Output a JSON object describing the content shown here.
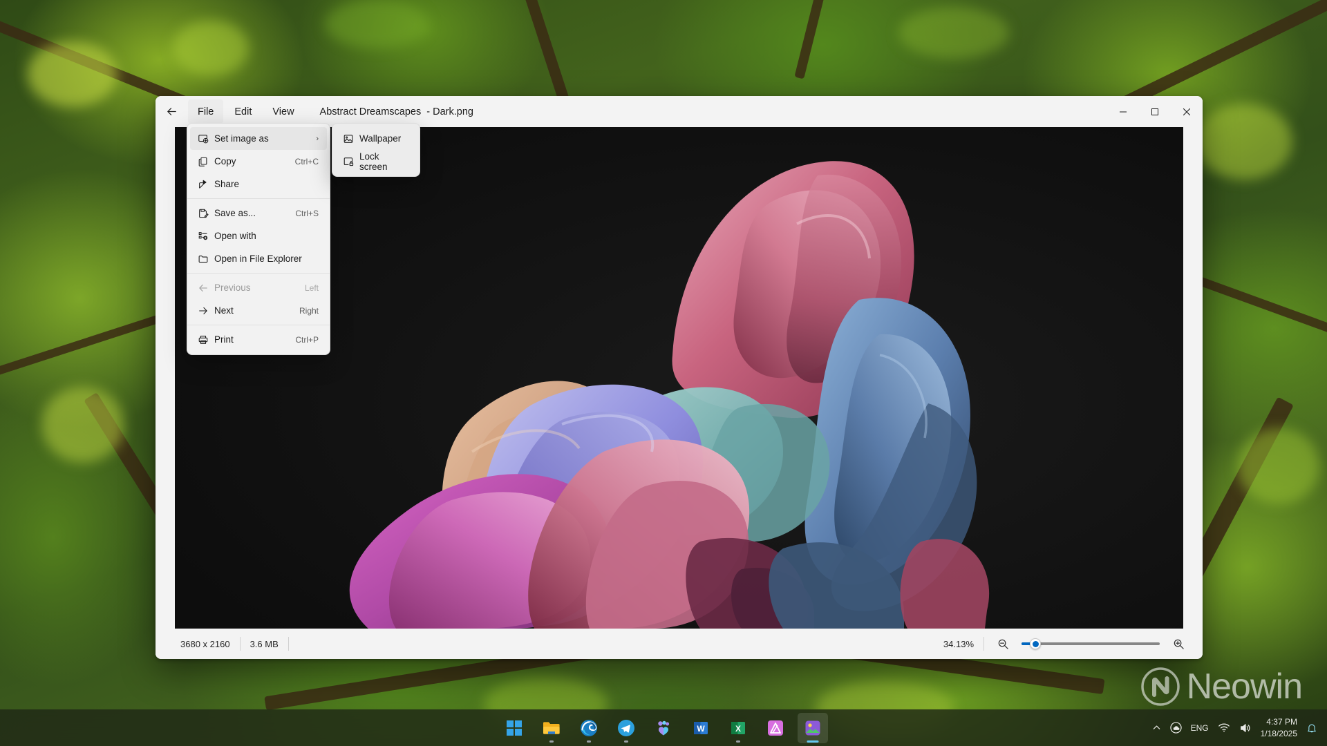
{
  "window": {
    "title": "Abstract Dreamscapes  - Dark.png",
    "back_icon": "back-arrow-icon",
    "menus": [
      {
        "label": "File",
        "active": true
      },
      {
        "label": "Edit",
        "active": false
      },
      {
        "label": "View",
        "active": false
      }
    ],
    "controls": {
      "minimize": "–",
      "maximize": "☐",
      "close": "✕"
    }
  },
  "file_menu": {
    "items": [
      {
        "label": "Set image as",
        "icon": "set-image-as-icon",
        "accel": "",
        "submenu": true,
        "disabled": false,
        "highlighted": true,
        "separator_after": false
      },
      {
        "label": "Copy",
        "icon": "copy-icon",
        "accel": "Ctrl+C",
        "submenu": false,
        "disabled": false,
        "highlighted": false,
        "separator_after": false
      },
      {
        "label": "Share",
        "icon": "share-icon",
        "accel": "",
        "submenu": false,
        "disabled": false,
        "highlighted": false,
        "separator_after": true
      },
      {
        "label": "Save as...",
        "icon": "save-as-icon",
        "accel": "Ctrl+S",
        "submenu": false,
        "disabled": false,
        "highlighted": false,
        "separator_after": false
      },
      {
        "label": "Open with",
        "icon": "open-with-icon",
        "accel": "",
        "submenu": false,
        "disabled": false,
        "highlighted": false,
        "separator_after": false
      },
      {
        "label": "Open in File Explorer",
        "icon": "folder-icon",
        "accel": "",
        "submenu": false,
        "disabled": false,
        "highlighted": false,
        "separator_after": true
      },
      {
        "label": "Previous",
        "icon": "arrow-left-icon",
        "accel": "Left",
        "submenu": false,
        "disabled": true,
        "highlighted": false,
        "separator_after": false
      },
      {
        "label": "Next",
        "icon": "arrow-right-icon",
        "accel": "Right",
        "submenu": false,
        "disabled": false,
        "highlighted": false,
        "separator_after": true
      },
      {
        "label": "Print",
        "icon": "printer-icon",
        "accel": "Ctrl+P",
        "submenu": false,
        "disabled": false,
        "highlighted": false,
        "separator_after": false
      }
    ]
  },
  "sub_menu": {
    "items": [
      {
        "label": "Wallpaper",
        "icon": "picture-icon"
      },
      {
        "label": "Lock screen",
        "icon": "lock-screen-icon"
      }
    ]
  },
  "status_bar": {
    "dimensions": "3680 x 2160",
    "file_size": "3.6 MB",
    "zoom_level": "34.13%",
    "zoom_out_icon": "zoom-out-icon",
    "zoom_in_icon": "zoom-in-icon",
    "slider_percent": 6
  },
  "watermark": {
    "text": "Neowin"
  },
  "taskbar": {
    "apps": [
      {
        "name": "start",
        "label": "Start",
        "active": false,
        "running": false
      },
      {
        "name": "file-explorer",
        "label": "File Explorer",
        "active": false,
        "running": true
      },
      {
        "name": "edge",
        "label": "Microsoft Edge",
        "active": false,
        "running": true
      },
      {
        "name": "telegram",
        "label": "Telegram",
        "active": false,
        "running": true
      },
      {
        "name": "teams",
        "label": "Microsoft Teams",
        "active": false,
        "running": false
      },
      {
        "name": "word",
        "label": "Word",
        "active": false,
        "running": false
      },
      {
        "name": "excel",
        "label": "Excel",
        "active": false,
        "running": true
      },
      {
        "name": "affinity",
        "label": "Affinity Photo",
        "active": false,
        "running": false
      },
      {
        "name": "photos",
        "label": "Photos",
        "active": true,
        "running": true
      }
    ],
    "tray": {
      "chevron": "show-hidden-icons",
      "onedrive": "onedrive-icon",
      "language": "ENG",
      "wifi": "wifi-icon",
      "volume": "volume-icon",
      "time": "4:37 PM",
      "date": "1/18/2025",
      "notification": "notification-bell-icon"
    }
  },
  "colors": {
    "accent": "#0067c0",
    "window_bg": "#f3f3f3",
    "menu_bg": "#f2f2f2",
    "viewer_bg": "#121212",
    "taskbar_bg": "rgba(32,40,22,.82)"
  }
}
